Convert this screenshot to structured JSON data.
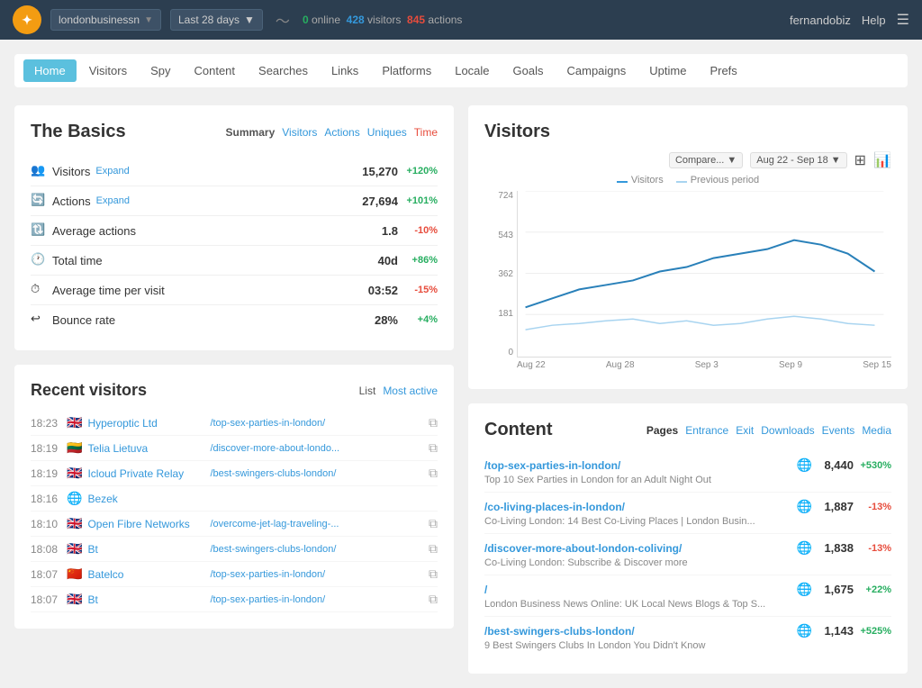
{
  "header": {
    "logo_text": "c",
    "site_selector": "londonbusinessn",
    "date_range": "Last 28 days",
    "online_label": "online",
    "online_count": "0",
    "visitors_count": "428",
    "visitors_label": "visitors",
    "actions_count": "845",
    "actions_label": "actions",
    "user": "fernandobiz",
    "help": "Help"
  },
  "nav": {
    "tabs": [
      {
        "label": "Home",
        "active": true
      },
      {
        "label": "Visitors",
        "active": false
      },
      {
        "label": "Spy",
        "active": false
      },
      {
        "label": "Content",
        "active": false
      },
      {
        "label": "Searches",
        "active": false
      },
      {
        "label": "Links",
        "active": false
      },
      {
        "label": "Platforms",
        "active": false
      },
      {
        "label": "Locale",
        "active": false
      },
      {
        "label": "Goals",
        "active": false
      },
      {
        "label": "Campaigns",
        "active": false
      },
      {
        "label": "Uptime",
        "active": false
      },
      {
        "label": "Prefs",
        "active": false
      }
    ]
  },
  "basics": {
    "title": "The Basics",
    "summary_tabs": {
      "label": "Summary",
      "tabs": [
        "Visitors",
        "Actions",
        "Uniques",
        "Time"
      ]
    },
    "rows": [
      {
        "icon": "visitors",
        "label": "Visitors",
        "expand": true,
        "value": "15,270",
        "change": "+120%",
        "positive": true
      },
      {
        "icon": "actions",
        "label": "Actions",
        "expand": true,
        "value": "27,694",
        "change": "+101%",
        "positive": true
      },
      {
        "icon": "avg-actions",
        "label": "Average actions",
        "expand": false,
        "value": "1.8",
        "change": "-10%",
        "positive": false
      },
      {
        "icon": "time",
        "label": "Total time",
        "expand": false,
        "value": "40d",
        "change": "+86%",
        "positive": true
      },
      {
        "icon": "time",
        "label": "Average time per visit",
        "expand": false,
        "value": "03:52",
        "change": "-15%",
        "positive": false
      },
      {
        "icon": "bounce",
        "label": "Bounce rate",
        "expand": false,
        "value": "28%",
        "change": "+4%",
        "positive": true
      }
    ]
  },
  "recent_visitors": {
    "title": "Recent visitors",
    "list_label": "List",
    "most_active_label": "Most active",
    "rows": [
      {
        "time": "18:23",
        "flag": "🇬🇧",
        "name": "Hyperoptic Ltd",
        "url": "/top-sex-parties-in-london/"
      },
      {
        "time": "18:19",
        "flag": "🇱🇹",
        "name": "Telia Lietuva",
        "url": "/discover-more-about-londo..."
      },
      {
        "time": "18:19",
        "flag": "🇬🇧",
        "name": "Icloud Private Relay",
        "url": "/best-swingers-clubs-london/"
      },
      {
        "time": "18:16",
        "flag": "🌐",
        "name": "Bezek",
        "url": ""
      },
      {
        "time": "18:10",
        "flag": "🇬🇧",
        "name": "Open Fibre Networks",
        "url": "/overcome-jet-lag-traveling-..."
      },
      {
        "time": "18:08",
        "flag": "🇬🇧",
        "name": "Bt",
        "url": "/best-swingers-clubs-london/"
      },
      {
        "time": "18:07",
        "flag": "🇨🇳",
        "name": "Batelco",
        "url": "/top-sex-parties-in-london/"
      },
      {
        "time": "18:07",
        "flag": "🇬🇧",
        "name": "Bt",
        "url": "/top-sex-parties-in-london/"
      }
    ]
  },
  "visitors_chart": {
    "title": "Visitors",
    "compare_label": "Compare...",
    "date_range": "Aug 22 - Sep 18",
    "legend": {
      "visitors": "Visitors",
      "previous": "Previous period"
    },
    "y_labels": [
      "724",
      "543",
      "362",
      "181",
      "0"
    ],
    "x_labels": [
      "Aug 22",
      "Aug 28",
      "Sep 3",
      "Sep 9",
      "Sep 15"
    ],
    "chart_icons": [
      "table-icon",
      "bar-chart-icon"
    ]
  },
  "content": {
    "title": "Content",
    "tabs": [
      "Pages",
      "Entrance",
      "Exit",
      "Downloads",
      "Events",
      "Media"
    ],
    "active_tab": "Pages",
    "items": [
      {
        "url": "/top-sex-parties-in-london/",
        "desc": "Top 10 Sex Parties in London for an Adult Night Out",
        "count": "8,440",
        "change": "+530%",
        "positive": true
      },
      {
        "url": "/co-living-places-in-london/",
        "desc": "Co-Living London: 14 Best Co-Living Places | London Busin...",
        "count": "1,887",
        "change": "-13%",
        "positive": false
      },
      {
        "url": "/discover-more-about-london-coliving/",
        "desc": "Co-Living London: Subscribe & Discover more",
        "count": "1,838",
        "change": "-13%",
        "positive": false
      },
      {
        "url": "/",
        "desc": "London Business News Online: UK Local News Blogs & Top S...",
        "count": "1,675",
        "change": "+22%",
        "positive": true
      },
      {
        "url": "/best-swingers-clubs-london/",
        "desc": "9 Best Swingers Clubs In London You Didn't Know",
        "count": "1,143",
        "change": "+525%",
        "positive": true
      }
    ]
  }
}
